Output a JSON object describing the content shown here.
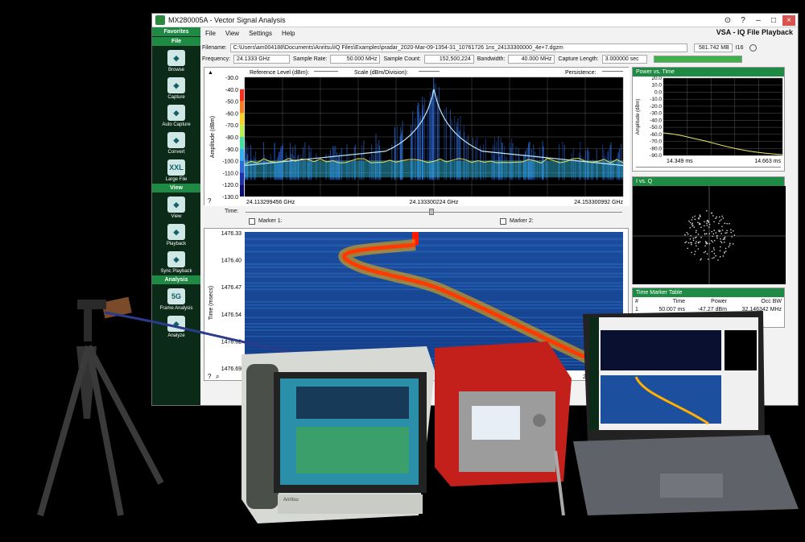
{
  "window": {
    "title": "MX280005A - Vector Signal Analysis",
    "app_title": "VSA - IQ File Playback",
    "colors": {
      "accent": "#1f8a43",
      "sidebar": "#0c2a18"
    }
  },
  "menu": [
    "File",
    "View",
    "Settings",
    "Help"
  ],
  "sidebar": {
    "sections": [
      {
        "header": "Favorites",
        "items": []
      },
      {
        "header": "File",
        "items": [
          {
            "label": "Browse",
            "icon": "browse-icon"
          },
          {
            "label": "Capture",
            "icon": "capture-icon"
          },
          {
            "label": "Auto Capture",
            "icon": "auto-capture-icon"
          },
          {
            "label": "Convert",
            "icon": "convert-icon"
          },
          {
            "label": "Large File",
            "icon": "large-file-icon",
            "glyph": "XXL"
          }
        ]
      },
      {
        "header": "View",
        "items": [
          {
            "label": "View",
            "icon": "view-icon"
          },
          {
            "label": "Playback",
            "icon": "playback-icon"
          },
          {
            "label": "Sync Playback",
            "icon": "sync-playback-icon"
          }
        ]
      },
      {
        "header": "Analysis",
        "items": [
          {
            "label": "Frame Analysis",
            "icon": "frame-analysis-icon",
            "glyph": "5G"
          },
          {
            "label": "Analyze",
            "icon": "analyze-icon"
          }
        ]
      }
    ]
  },
  "file_info": {
    "filename_label": "Filename:",
    "filename": "C:\\Users\\am004188\\Documents\\Anritsu\\IQ Files\\Examples\\pradar_2020-Mar-09-1354-31_10761726 1ns_24133300000_4e+7.dgzm",
    "size": "581.742 MB",
    "bits": "I16",
    "frequency_label": "Frequency:",
    "frequency": "24.1333 GHz",
    "sample_rate_label": "Sample Rate:",
    "sample_rate": "50.000 MHz",
    "sample_count_label": "Sample Count:",
    "sample_count": "152,500,224",
    "bandwidth_label": "Bandwidth:",
    "bandwidth": "40.000 MHz",
    "capture_length_label": "Capture Length:",
    "capture_length": "3.000000 sec",
    "capture_progress": 1.0
  },
  "spectrum": {
    "reference_level_label": "Reference Level (dBm):",
    "scale_label": "Scale (dBm/Division):",
    "persistence_label": "Persistence:",
    "ylabel": "Amplitude (dBm)",
    "y_ticks": [
      "-30.0",
      "-40.0",
      "-50.0",
      "-60.0",
      "-70.0",
      "-80.0",
      "-90.0",
      "-100.0",
      "-110.0",
      "-120.0",
      "-130.0"
    ],
    "x_ticks": [
      "24.113299456 GHz",
      "24.133300224 GHz",
      "24.153300992 GHz"
    ],
    "ylim": [
      -130,
      -30
    ]
  },
  "time_control": {
    "time_label": "Time:",
    "marker1_label": "Marker 1:",
    "marker2_label": "Marker 2:"
  },
  "spectrogram": {
    "ylabel": "Time (msecs)",
    "y_ticks": [
      "1476.33",
      "1476.40",
      "1476.47",
      "1476.54",
      "1476.62",
      "1476.69"
    ],
    "x_tick_partial": "24.15"
  },
  "power_vs_time": {
    "title": "Power vs. Time",
    "ylabel": "Amplitude (dBm)",
    "y_ticks": [
      "20.0",
      "10.0",
      "0.0",
      "-10.0",
      "-20.0",
      "-30.0",
      "-40.0",
      "-50.0",
      "-60.0",
      "-70.0",
      "-80.0",
      "-90.0"
    ],
    "x_ticks": [
      "14.349 ms",
      "14.663 ms"
    ]
  },
  "iq": {
    "title": "I vs. Q"
  },
  "marker_table": {
    "title": "Time Marker Table",
    "headers": [
      "#",
      "Time",
      "Power",
      "Occ BW"
    ],
    "rows": [
      [
        "1",
        "50.007 ms",
        "-47.27 dBm",
        "32.146342 MHz"
      ]
    ]
  },
  "hardware_text": {
    "handheld_brand": "Anritsu"
  }
}
